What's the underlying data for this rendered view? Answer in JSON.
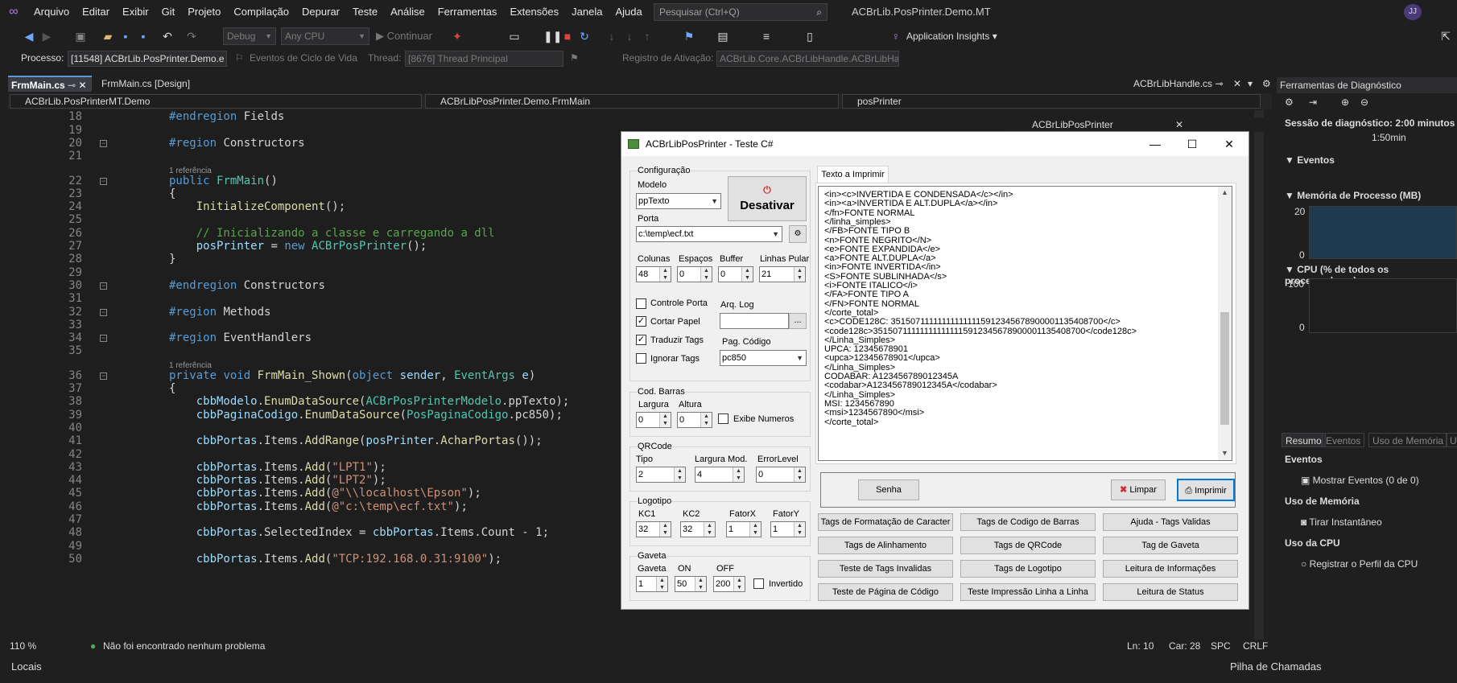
{
  "menu": {
    "items": [
      "Arquivo",
      "Editar",
      "Exibir",
      "Git",
      "Projeto",
      "Compilação",
      "Depurar",
      "Teste",
      "Análise",
      "Ferramentas",
      "Extensões",
      "Janela",
      "Ajuda"
    ],
    "search_placeholder": "Pesquisar (Ctrl+Q)",
    "window_title": "ACBrLib.PosPrinter.Demo.MT",
    "user_initials": "JJ"
  },
  "toolbar": {
    "config": "Debug",
    "platform": "Any CPU",
    "continue_label": "Continuar",
    "app_insights": "Application Insights"
  },
  "toolbar2": {
    "process_label": "Processo:",
    "process_value": "[11548] ACBrLib.PosPrinter.Demo.e",
    "lifecycle_label": "Eventos de Ciclo de Vida",
    "thread_label": "Thread:",
    "thread_value": "[8676] Thread Principal",
    "activation_label": "Registro de Ativação:",
    "activation_value": "ACBrLib.Core.ACBrLibHandle.ACBrLibHar"
  },
  "tabs": {
    "frmmain_cs": "FrmMain.cs",
    "frmmain_design": "FrmMain.cs [Design]",
    "handle": "ACBrLibHandle.cs"
  },
  "nav": {
    "project": "ACBrLib.PosPrinterMT.Demo",
    "class": "ACBrLibPosPrinter.Demo.FrmMain",
    "member": "posPrinter"
  },
  "editor": {
    "lines": [
      {
        "n": "18",
        "html": "<span class='kw'>#endregion</span> Fields"
      },
      {
        "n": "19",
        "html": ""
      },
      {
        "n": "20",
        "html": "<span class='kw'>#region</span> Constructors"
      },
      {
        "n": "21",
        "html": ""
      },
      {
        "n": "22",
        "html": "<span class='kw'>public</span> <span class='ty'>FrmMain</span>()"
      },
      {
        "n": "23",
        "html": "{"
      },
      {
        "n": "24",
        "html": "    <span class='fn'>InitializeComponent</span>();"
      },
      {
        "n": "25",
        "html": ""
      },
      {
        "n": "26",
        "html": "    <span class='cm'>// Inicializando a classe e carregando a dll</span>"
      },
      {
        "n": "27",
        "html": "    <span class='va'>posPrinter</span> = <span class='kw'>new</span> <span class='ty'>ACBrPosPrinter</span>();"
      },
      {
        "n": "28",
        "html": "}"
      },
      {
        "n": "29",
        "html": ""
      },
      {
        "n": "30",
        "html": "<span class='kw'>#endregion</span> Constructors"
      },
      {
        "n": "31",
        "html": ""
      },
      {
        "n": "32",
        "html": "<span class='kw'>#region</span> Methods"
      },
      {
        "n": "33",
        "html": ""
      },
      {
        "n": "34",
        "html": "<span class='kw'>#region</span> EventHandlers"
      },
      {
        "n": "35",
        "html": ""
      },
      {
        "n": "36",
        "html": "<span class='kw'>private</span> <span class='kw'>void</span> <span class='fn'>FrmMain_Shown</span>(<span class='kw'>object</span> <span class='va'>sender</span>, <span class='ty'>EventArgs</span> <span class='va'>e</span>)"
      },
      {
        "n": "37",
        "html": "{"
      },
      {
        "n": "38",
        "html": "    <span class='va'>cbbModelo</span>.<span class='fn'>EnumDataSource</span>(<span class='ty'>ACBrPosPrinterModelo</span>.ppTexto);"
      },
      {
        "n": "39",
        "html": "    <span class='va'>cbbPaginaCodigo</span>.<span class='fn'>EnumDataSource</span>(<span class='ty'>PosPaginaCodigo</span>.pc850);"
      },
      {
        "n": "40",
        "html": ""
      },
      {
        "n": "41",
        "html": "    <span class='va'>cbbPortas</span>.Items.<span class='fn'>AddRange</span>(<span class='va'>posPrinter</span>.<span class='fn'>AcharPortas</span>());"
      },
      {
        "n": "42",
        "html": ""
      },
      {
        "n": "43",
        "html": "    <span class='va'>cbbPortas</span>.Items.<span class='fn'>Add</span>(<span class='st'>\"LPT1\"</span>);"
      },
      {
        "n": "44",
        "html": "    <span class='va'>cbbPortas</span>.Items.<span class='fn'>Add</span>(<span class='st'>\"LPT2\"</span>);"
      },
      {
        "n": "45",
        "html": "    <span class='va'>cbbPortas</span>.Items.<span class='fn'>Add</span>(<span class='st'>@\"\\\\localhost\\Epson\"</span>);"
      },
      {
        "n": "46",
        "html": "    <span class='va'>cbbPortas</span>.Items.<span class='fn'>Add</span>(<span class='st'>@\"c:\\temp\\ecf.txt\"</span>);"
      },
      {
        "n": "47",
        "html": ""
      },
      {
        "n": "48",
        "html": "    <span class='va'>cbbPortas</span>.SelectedIndex = <span class='va'>cbbPortas</span>.Items.Count - 1;"
      },
      {
        "n": "49",
        "html": ""
      },
      {
        "n": "50",
        "html": "    <span class='va'>cbbPortas</span>.Items.<span class='fn'>Add</span>(<span class='st'>\"TCP:192.168.0.31:9100\"</span>);"
      }
    ],
    "ref_label": "1 referência"
  },
  "status": {
    "zoom": "110 %",
    "problems": "Não foi encontrado nenhum problema",
    "line": "Ln: 10",
    "col": "Car: 28",
    "spc": "SPC",
    "crlf": "CRLF"
  },
  "bottom": {
    "locals": "Locais",
    "callstack": "Pilha de Chamadas"
  },
  "floating": {
    "title": "ACBrLibPosPrinter"
  },
  "diag": {
    "header": "Ferramentas de Diagnóstico",
    "session": "Sessão de diagnóstico: 2:00 minutos",
    "time_tick": "1:50min",
    "events": "Eventos",
    "memory": "Memória de Processo (MB)",
    "mem_top": "20",
    "mem_bottom": "0",
    "cpu": "CPU (% de todos os processadores)",
    "cpu_top": "100",
    "cpu_bottom": "0",
    "tabs": [
      "Resumo",
      "Eventos",
      "Uso de Memória",
      "U"
    ],
    "events_title": "Eventos",
    "show_events": "Mostrar Eventos (0 de 0)",
    "memory_usage": "Uso de Memória",
    "snapshot": "Tirar Instantâneo",
    "cpu_usage": "Uso da CPU",
    "cpu_profile": "Registrar o Perfil da CPU"
  },
  "dialog": {
    "title": "ACBrLibPosPrinter - Teste C#",
    "config_group": "Configuração",
    "modelo_label": "Modelo",
    "modelo_value": "ppTexto",
    "desativar": "Desativar",
    "porta_label": "Porta",
    "porta_value": "c:\\temp\\ecf.txt",
    "colunas_label": "Colunas",
    "colunas_value": "48",
    "espacos_label": "Espaços",
    "espacos_value": "0",
    "buffer_label": "Buffer",
    "buffer_value": "0",
    "linhas_label": "Linhas Pular",
    "linhas_value": "21",
    "controle_porta": "Controle Porta",
    "cortar_papel": "Cortar Papel",
    "traduzir_tags": "Traduzir Tags",
    "ignorar_tags": "Ignorar Tags",
    "arq_log": "Arq. Log",
    "browse": "...",
    "pag_codigo_label": "Pag. Código",
    "pag_codigo_value": "pc850",
    "cod_barras_group": "Cod. Barras",
    "largura_label": "Largura",
    "largura_value": "0",
    "altura_label": "Altura",
    "altura_value": "0",
    "exibe_numeros": "Exibe Numeros",
    "qrcode_group": "QRCode",
    "tipo_label": "Tipo",
    "tipo_value": "2",
    "largura_mod_label": "Largura Mod.",
    "largura_mod_value": "4",
    "error_level_label": "ErrorLevel",
    "error_level_value": "0",
    "logotipo_group": "Logotipo",
    "kc1_label": "KC1",
    "kc1_value": "32",
    "kc2_label": "KC2",
    "kc2_value": "32",
    "fatorx_label": "FatorX",
    "fatorx_value": "1",
    "fatory_label": "FatorY",
    "fatory_value": "1",
    "gaveta_group": "Gaveta",
    "gaveta_label": "Gaveta",
    "gaveta_value": "1",
    "on_label": "ON",
    "on_value": "50",
    "off_label": "OFF",
    "off_value": "200",
    "invertido": "Invertido",
    "text_tab": "Texto a Imprimir",
    "text_lines": [
      "<in><c>INVERTIDA E CONDENSADA</c></in>",
      "<in><a>INVERTIDA E ALT.DUPLA</a></in>",
      "</fn>FONTE NORMAL",
      "</linha_simples>",
      "</FB>FONTE TIPO B",
      "<n>FONTE NEGRITO</N>",
      "<e>FONTE EXPANDIDA</e>",
      "<a>FONTE ALT.DUPLA</a>",
      "<in>FONTE INVERTIDA</in>",
      "<S>FONTE SUBLINHADA</s>",
      "<i>FONTE ITALICO</i>",
      "</FA>FONTE TIPO A",
      "</FN>FONTE NORMAL",
      "</corte_total>",
      "<c>CODE128C: 351507111111111111115912345678900001135408700</c>",
      "<code128c>351507111111111111115912345678900001135408700</code128c>",
      "</Linha_Simples>",
      "UPCA: 12345678901",
      "<upca>12345678901</upca>",
      "</Linha_Simples>",
      "CODABAR: A123456789012345A",
      "<codabar>A123456789012345A</codabar>",
      "</Linha_Simples>",
      "MSI: 1234567890",
      "<msi>1234567890</msi>",
      "</corte_total>"
    ],
    "senha": "Senha",
    "limpar": "Limpar",
    "imprimir": "Imprimir",
    "buttons": [
      "Tags de Formatação de Caracter",
      "Tags de Codigo de Barras",
      "Ajuda - Tags Validas",
      "Tags de Alinhamento",
      "Tags de QRCode",
      "Tag de Gaveta",
      "Teste de Tags Invalidas",
      "Tags de Logotipo",
      "Leitura de Informações",
      "Teste de Página de Código",
      "Teste Impressão Linha a Linha",
      "Leitura de Status"
    ]
  }
}
